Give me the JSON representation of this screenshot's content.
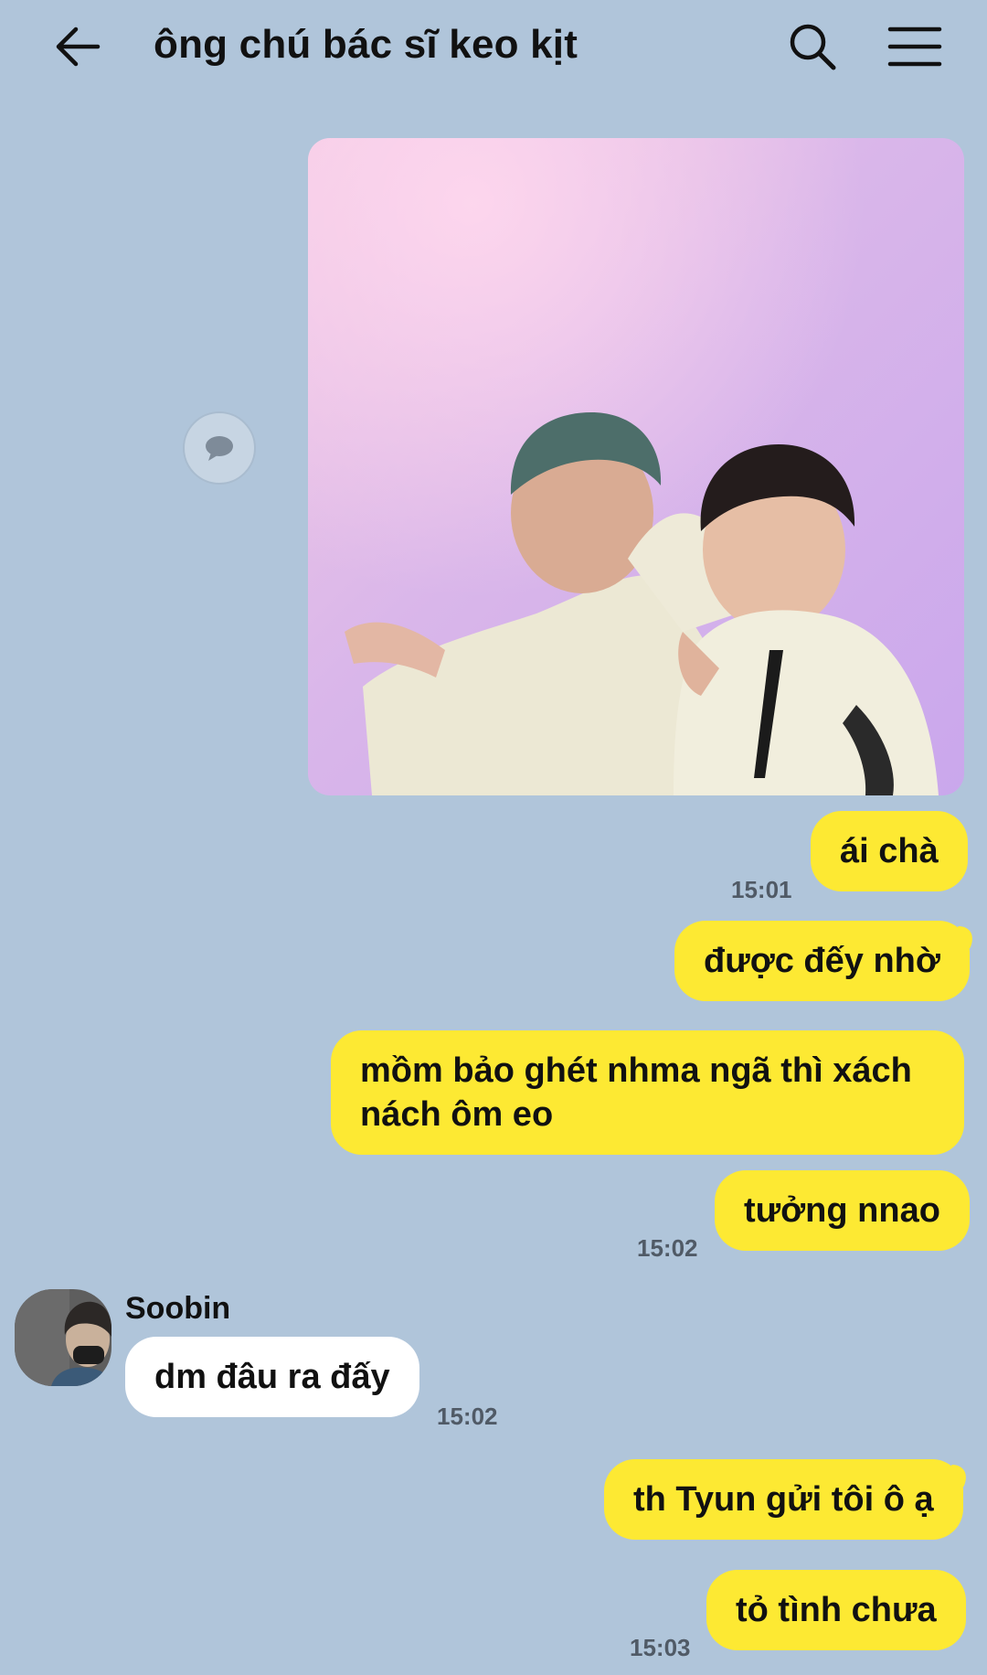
{
  "header": {
    "title": "ông chú bác sĩ keo kịt",
    "icons": [
      "arrow-left-icon",
      "search-icon",
      "hamburger-menu-icon"
    ]
  },
  "colors": {
    "background": "#b0c5da",
    "my_bubble": "#fde933",
    "other_bubble": "#ffffff",
    "timestamp": "#505a66"
  },
  "messages": [
    {
      "from": "me",
      "type": "image"
    },
    {
      "from": "me",
      "text": "ái chà",
      "time": "15:01"
    },
    {
      "from": "me",
      "text": "được đếy nhờ"
    },
    {
      "from": "me",
      "text": "mồm bảo ghét nhma ngã thì xách nách ôm eo"
    },
    {
      "from": "me",
      "text": "tưởng nnao",
      "time": "15:02"
    },
    {
      "from": "other",
      "sender": "Soobin",
      "text": "dm đâu ra đấy",
      "time": "15:02"
    },
    {
      "from": "me",
      "text": "th Tyun gửi tôi ô ạ"
    },
    {
      "from": "me",
      "text": "tỏ tình chưa",
      "time": "15:03"
    }
  ]
}
